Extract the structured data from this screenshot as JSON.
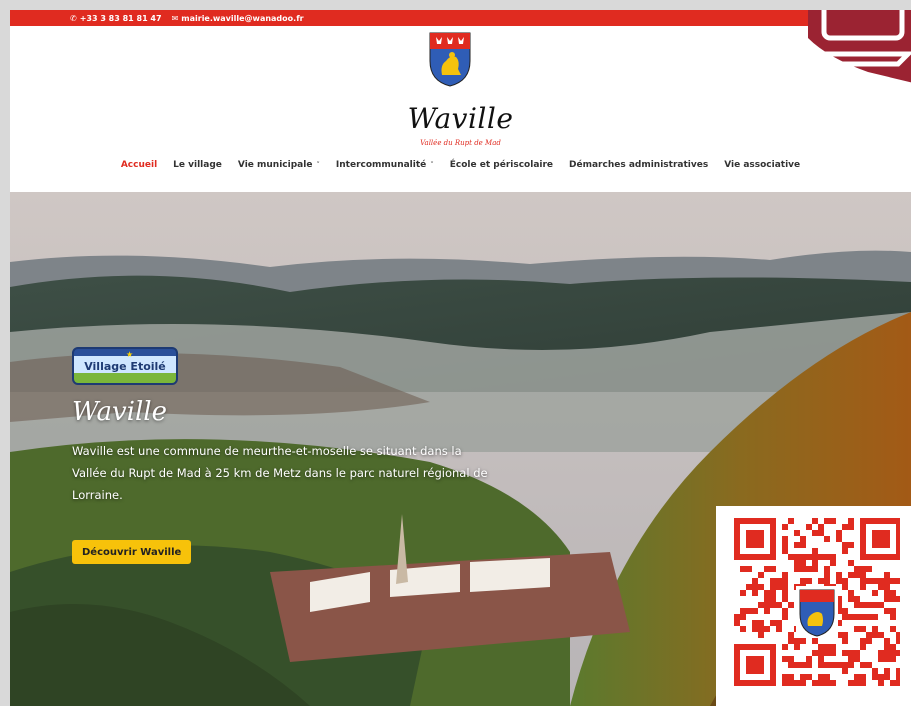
{
  "topbar": {
    "phone": "+33 3 83 81 81 47",
    "email": "mairie.waville@wanadoo.fr",
    "phone_icon": "phone-icon",
    "email_icon": "envelope-icon"
  },
  "header": {
    "logo": "Waville",
    "tagline": "Vallée du Rupt de Mad"
  },
  "nav": {
    "items": [
      {
        "label": "Accueil",
        "active": true,
        "dropdown": false
      },
      {
        "label": "Le village",
        "active": false,
        "dropdown": false
      },
      {
        "label": "Vie municipale",
        "active": false,
        "dropdown": true
      },
      {
        "label": "Intercommunalité",
        "active": false,
        "dropdown": true
      },
      {
        "label": "École et périscolaire",
        "active": false,
        "dropdown": false
      },
      {
        "label": "Démarches administratives",
        "active": false,
        "dropdown": false
      },
      {
        "label": "Vie associative",
        "active": false,
        "dropdown": false
      }
    ],
    "chevron": "˅"
  },
  "hero": {
    "badge": "Village Etoilé",
    "title": "Waville",
    "description": "Waville est une commune de meurthe-et-moselle se situant dans la Vallée du Rupt de Mad à 25 km de Metz dans le parc naturel régional de Lorraine.",
    "cta": "Découvrir Waville"
  },
  "colors": {
    "accent": "#e02b20",
    "cta": "#f7c20a",
    "qr": "#e02b20"
  }
}
